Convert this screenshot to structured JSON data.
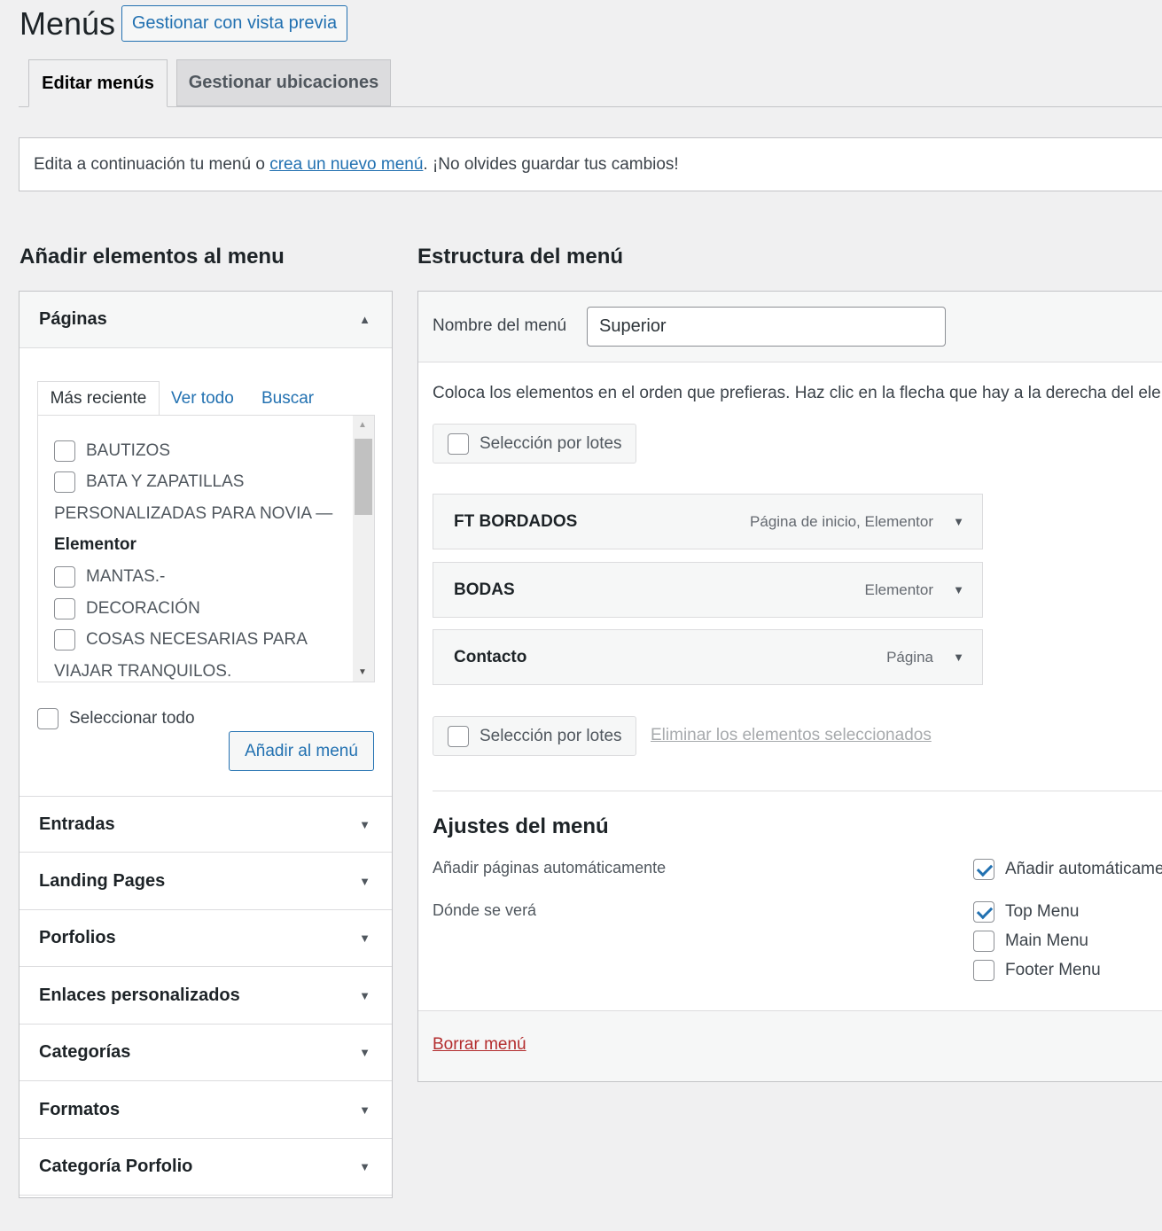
{
  "header": {
    "title": "Menús",
    "preview_button": "Gestionar con vista previa"
  },
  "tabs": [
    {
      "label": "Editar menús"
    },
    {
      "label": "Gestionar ubicaciones"
    }
  ],
  "notice": {
    "before": "Edita a continuación tu menú o ",
    "link": "crea un nuevo menú",
    "after": ". ¡No olvides guardar tus cambios!"
  },
  "left": {
    "heading": "Añadir elementos al menu",
    "pages_panel": {
      "title": "Páginas",
      "tabs": [
        "Más reciente",
        "Ver todo",
        "Buscar"
      ],
      "items": [
        "BAUTIZOS",
        "BATA Y ZAPATILLAS",
        "PERSONALIZADAS PARA NOVIA —",
        "Elementor",
        "MANTAS.-",
        "DECORACIÓN",
        "COSAS NECESARIAS PARA",
        "VIAJAR TRANQUILOS."
      ],
      "select_all": "Seleccionar todo",
      "add_button": "Añadir al menú"
    },
    "other_panels": [
      "Entradas",
      "Landing Pages",
      "Porfolios",
      "Enlaces personalizados",
      "Categorías",
      "Formatos",
      "Categoría Porfolio"
    ]
  },
  "right": {
    "heading": "Estructura del menú",
    "menu_name_label": "Nombre del menú",
    "menu_name_value": "Superior",
    "instructions": "Coloca los elementos en el orden que prefieras. Haz clic en la flecha que hay a la derecha del ele",
    "bulk_select": "Selección por lotes",
    "menu_items": [
      {
        "title": "FT BORDADOS",
        "type": "Página de inicio, Elementor"
      },
      {
        "title": "BODAS",
        "type": "Elementor"
      },
      {
        "title": "Contacto",
        "type": "Página"
      }
    ],
    "delete_selected": "Eliminar los elementos seleccionados",
    "settings": {
      "heading": "Ajustes del menú",
      "auto_add_label": "Añadir páginas automáticamente",
      "auto_add_option": "Añadir automáticame",
      "locations_label": "Dónde se verá",
      "locations": [
        {
          "name": "Top Menu",
          "checked": true
        },
        {
          "name": "Main Menu",
          "checked": false
        },
        {
          "name": "Footer Menu",
          "checked": false
        }
      ]
    },
    "delete_menu": "Borrar menú"
  }
}
